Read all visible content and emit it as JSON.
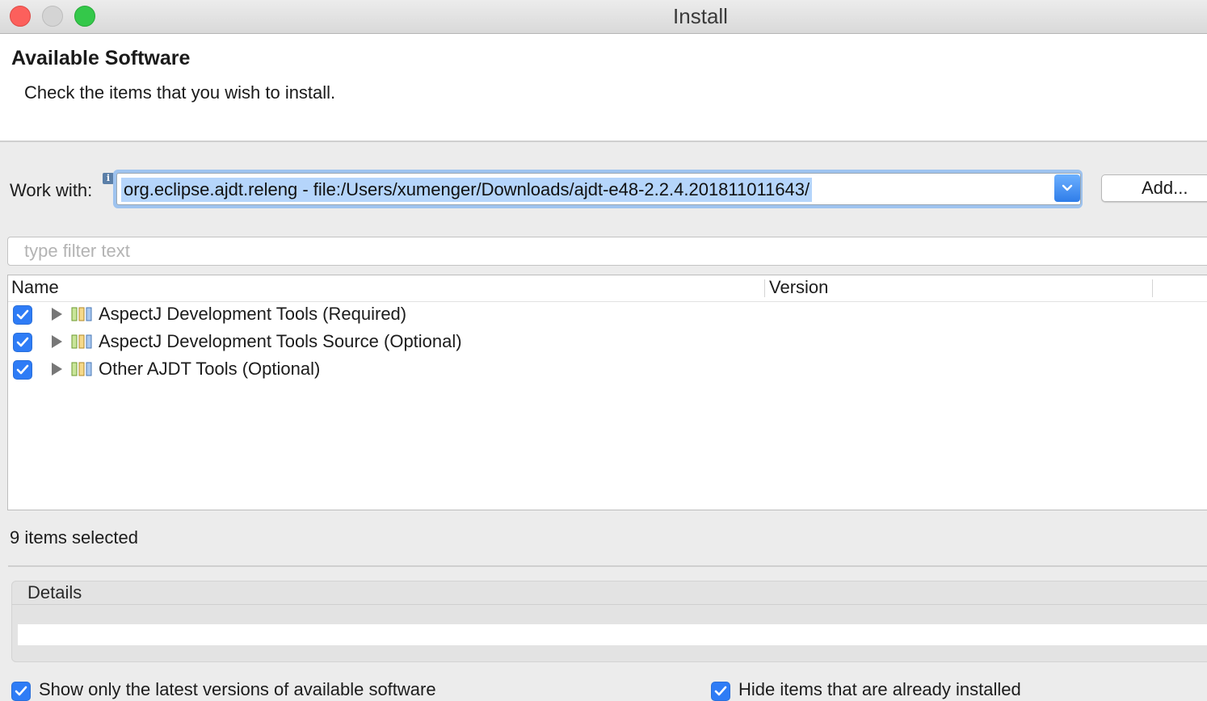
{
  "window": {
    "title": "Install"
  },
  "header": {
    "title": "Available Software",
    "subtitle": "Check the items that you wish to install."
  },
  "work_with": {
    "label": "Work with:",
    "value": "org.eclipse.ajdt.releng - file:/Users/xumenger/Downloads/ajdt-e48-2.2.4.201811011643/",
    "add_button": "Add..."
  },
  "filter": {
    "placeholder": "type filter text"
  },
  "table": {
    "columns": [
      "Name",
      "Version"
    ],
    "rows": [
      {
        "label": "AspectJ Development Tools (Required)",
        "checked": true
      },
      {
        "label": "AspectJ Development Tools Source (Optional)",
        "checked": true
      },
      {
        "label": "Other AJDT Tools (Optional)",
        "checked": true
      }
    ]
  },
  "status": "9 items selected",
  "details": {
    "label": "Details"
  },
  "options": [
    {
      "label": "Show only the latest versions of available software",
      "checked": true
    },
    {
      "label": "Hide items that are already installed",
      "checked": true
    }
  ],
  "colors": {
    "accent": "#2e7cf6",
    "selection": "#b5d5fb",
    "focus_ring": "#9ec3ef"
  }
}
